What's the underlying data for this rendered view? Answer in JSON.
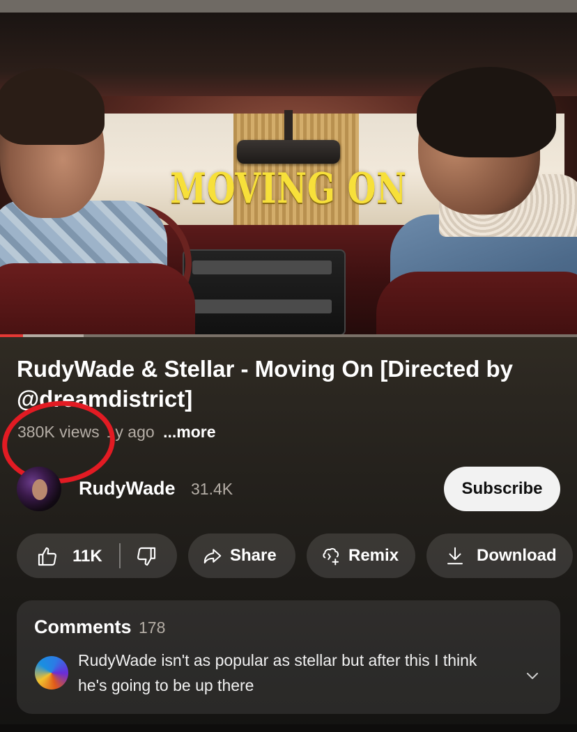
{
  "video": {
    "overlay_title": "MOVING ON",
    "progress": {
      "played_fraction": 0.04,
      "buffered_fraction": 0.145
    }
  },
  "info": {
    "title": "RudyWade & Stellar - Moving On [Directed by @dreamdistrict]",
    "views": "380K views",
    "age": "1y ago",
    "more_label": "...more"
  },
  "channel": {
    "name": "RudyWade",
    "subscribers": "31.4K",
    "subscribe_label": "Subscribe"
  },
  "actions": {
    "like_count": "11K",
    "share_label": "Share",
    "remix_label": "Remix",
    "download_label": "Download"
  },
  "comments": {
    "title": "Comments",
    "count": "178",
    "top_comment": "RudyWade isn't as popular as stellar but after this I think he's going to be up there"
  },
  "colors": {
    "annotation_circle": "#e21b23",
    "progress_played": "#e53935",
    "subscribe_bg": "#f2f2f2",
    "title_overlay": "#f7e03a"
  },
  "icons": {
    "like": "thumbs-up-icon",
    "dislike": "thumbs-down-icon",
    "share": "share-arrow-icon",
    "remix": "remix-icon",
    "download": "download-icon",
    "expand": "chevron-down-icon"
  }
}
